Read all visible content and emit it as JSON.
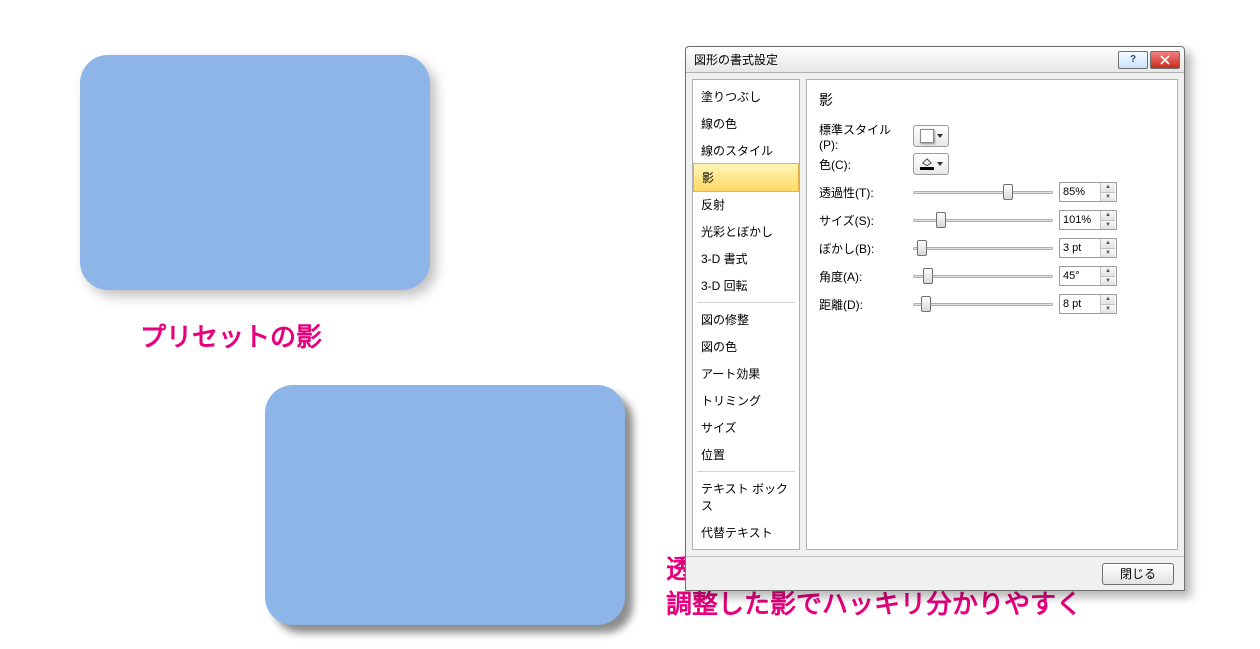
{
  "caption1": "プリセットの影",
  "caption2": "透過性、距離、ぼかし具合を\n調整した影でハッキリ分かりやすく",
  "dialog": {
    "title": "図形の書式設定",
    "help_symbol": "?",
    "nav": {
      "items": [
        "塗りつぶし",
        "線の色",
        "線のスタイル",
        "影",
        "反射",
        "光彩とぼかし",
        "3-D 書式",
        "3-D 回転",
        "図の修整",
        "図の色",
        "アート効果",
        "トリミング",
        "サイズ",
        "位置",
        "テキスト ボックス",
        "代替テキスト"
      ],
      "selected_index": 3
    },
    "panel": {
      "title": "影",
      "preset_label": "標準スタイル(P):",
      "color_label": "色(C):",
      "rows": [
        {
          "label": "透過性(T):",
          "value": "85%",
          "thumb_pct": 70
        },
        {
          "label": "サイズ(S):",
          "value": "101%",
          "thumb_pct": 18
        },
        {
          "label": "ぼかし(B):",
          "value": "3 pt",
          "thumb_pct": 3
        },
        {
          "label": "角度(A):",
          "value": "45°",
          "thumb_pct": 8
        },
        {
          "label": "距離(D):",
          "value": "8 pt",
          "thumb_pct": 6
        }
      ]
    },
    "close_button": "閉じる"
  }
}
